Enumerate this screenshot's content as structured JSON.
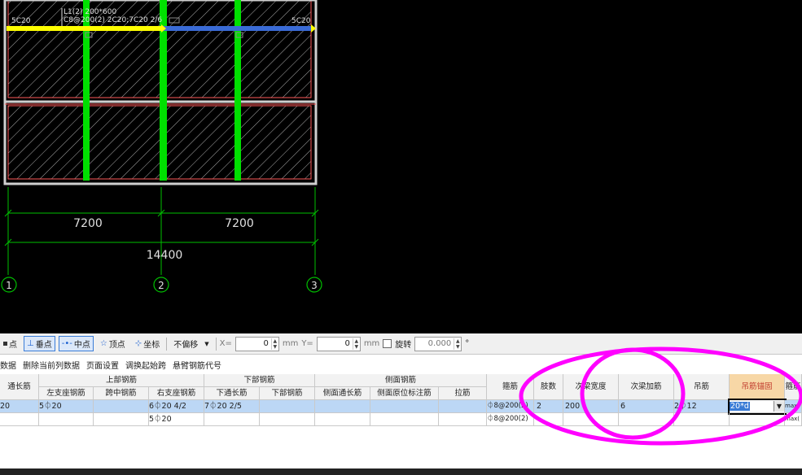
{
  "canvas": {
    "beam_label_1": "L1(2) 200*600",
    "beam_label_2": "C8@200(2) 2C20;7C20 2/6",
    "end_label_left": "5C20",
    "end_label_right": "5C20",
    "dims": {
      "span_1": "7200",
      "span_2": "7200",
      "total": "14400"
    },
    "axes": [
      "1",
      "2",
      "3"
    ]
  },
  "toolbar": {
    "items": [
      {
        "label": "点",
        "icon": "point-icon"
      },
      {
        "label": "垂点",
        "icon": "perpendicular-icon",
        "active": true
      },
      {
        "label": "中点",
        "icon": "midpoint-icon",
        "active": true
      },
      {
        "label": "顶点",
        "icon": "vertex-icon"
      },
      {
        "label": "坐标",
        "icon": "coordinate-icon"
      }
    ],
    "offset_mode": "不偏移",
    "x_label": "X=",
    "x_value": "0",
    "y_label": "Y=",
    "y_value": "0",
    "unit": "mm",
    "rotate_label": "旋转",
    "rotate_value": "0.000",
    "degree": "°"
  },
  "menubar": [
    "数据",
    "删除当前列数据",
    "页面设置",
    "调换起始跨",
    "悬臂钢筋代号"
  ],
  "table": {
    "header_groups": {
      "through": "通长筋",
      "top": "上部钢筋",
      "bottom": "下部钢筋",
      "side": "侧面钢筋"
    },
    "subheaders": {
      "left_support": "左支座钢筋",
      "mid_span": "跨中钢筋",
      "right_support": "右支座钢筋",
      "bottom_through": "下通长筋",
      "bottom_rebar": "下部钢筋",
      "side_through": "侧面通长筋",
      "side_original": "侧面原位标注筋",
      "tie": "拉筋"
    },
    "headers": {
      "stirrup": "箍筋",
      "legs": "肢数",
      "sec_width": "次梁宽度",
      "sec_add": "次梁加筋",
      "hanger": "吊筋",
      "hanger_anchor": "吊筋锚固",
      "stirrup_more": "箍筋"
    },
    "rows": [
      {
        "through": "20",
        "left_support": "5⏀20",
        "mid_span": "",
        "right_support": "6⏀20 4/2",
        "bottom_through": "7⏀20 2/5",
        "bottom_rebar": "",
        "side_through": "",
        "side_original": "",
        "tie": "",
        "stirrup": "⏀8@200(2)",
        "legs": "2",
        "sec_width": "200",
        "sec_add": "6",
        "hanger": "2⏀12",
        "hanger_anchor": "20*d",
        "stirrup_more": "max("
      },
      {
        "through": "",
        "left_support": "",
        "mid_span": "",
        "right_support": "5⏀20",
        "bottom_through": "",
        "bottom_rebar": "",
        "side_through": "",
        "side_original": "",
        "tie": "",
        "stirrup": "⏀8@200(2)",
        "legs": "",
        "sec_width": "",
        "sec_add": "",
        "hanger": "",
        "hanger_anchor": "",
        "stirrup_more": "max("
      }
    ]
  },
  "colors": {
    "beam_green": "#00e000",
    "beam_yellow": "#ffff00",
    "beam_blue": "#3a6bd6",
    "annotation_magenta": "#ff00ff",
    "header_highlight": "#f7d7a6"
  }
}
